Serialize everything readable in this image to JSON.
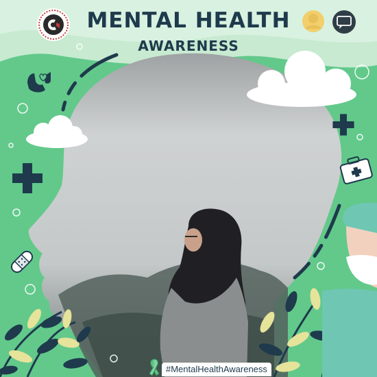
{
  "header": {
    "title": "MENTAL HEALTH",
    "subtitle": "AWARENESS"
  },
  "footer": {
    "hashtag": "#MentalHealthAwareness"
  },
  "icons": [
    "logo-emblem-icon",
    "user-avatar-icon",
    "chat-bubble-icon",
    "hands-heart-icon",
    "medical-cross-icon",
    "first-aid-kit-icon",
    "bandage-icon",
    "awareness-ribbon-icon"
  ],
  "colors": {
    "green": "#62c98b",
    "light_green": "#9ee0b4",
    "navy": "#1e3a4c",
    "leaf_yellow": "#e6e39a",
    "photo_fog": "#c9cdcd"
  }
}
